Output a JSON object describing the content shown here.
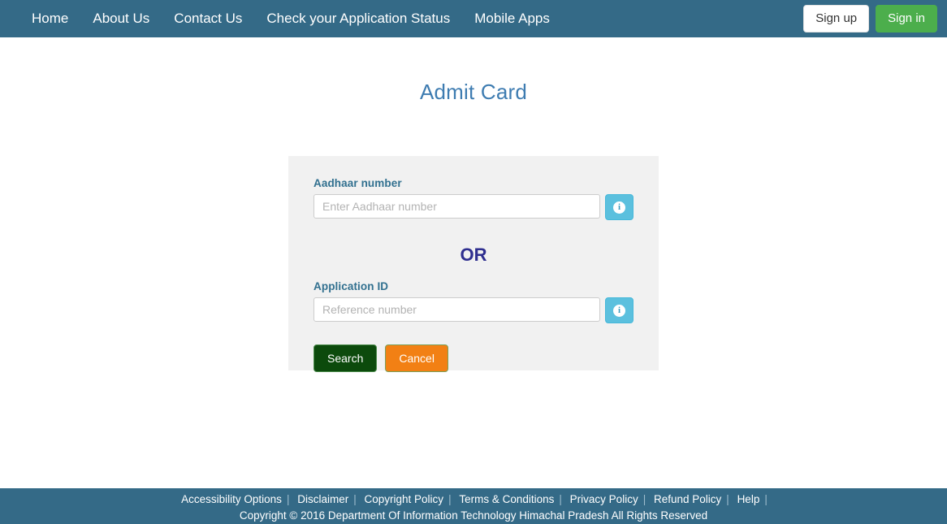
{
  "navbar": {
    "links": [
      {
        "label": "Home"
      },
      {
        "label": "About Us"
      },
      {
        "label": "Contact Us"
      },
      {
        "label": "Check your Application Status"
      },
      {
        "label": "Mobile Apps"
      }
    ],
    "sign_up_label": "Sign up",
    "sign_in_label": "Sign in",
    "background_color": "#346a87",
    "sign_in_color": "#4cae4c"
  },
  "main": {
    "page_title": "Admit Card",
    "title_color": "#3e7cb1",
    "panel_background": "#f1f1f1",
    "aadhaar": {
      "label": "Aadhaar number",
      "value": "",
      "placeholder": "Enter Aadhaar number",
      "info_icon": "info-icon",
      "info_glyph": "i"
    },
    "or_label": "OR",
    "or_color": "#2e2e8f",
    "application": {
      "label": "Application ID",
      "value": "",
      "placeholder": "Reference number",
      "info_icon": "info-icon",
      "info_glyph": "i"
    },
    "search_label": "Search",
    "search_color": "#0c4a0c",
    "cancel_label": "Cancel",
    "cancel_color": "#f28014"
  },
  "footer": {
    "links": [
      {
        "label": "Accessibility Options"
      },
      {
        "label": "Disclaimer"
      },
      {
        "label": "Copyright Policy"
      },
      {
        "label": "Terms & Conditions"
      },
      {
        "label": "Privacy Policy"
      },
      {
        "label": "Refund Policy"
      },
      {
        "label": "Help"
      }
    ],
    "separator": "|",
    "copyright": "Copyright © 2016 Department Of Information Technology Himachal Pradesh All Rights Reserved",
    "background_color": "#346a87"
  }
}
